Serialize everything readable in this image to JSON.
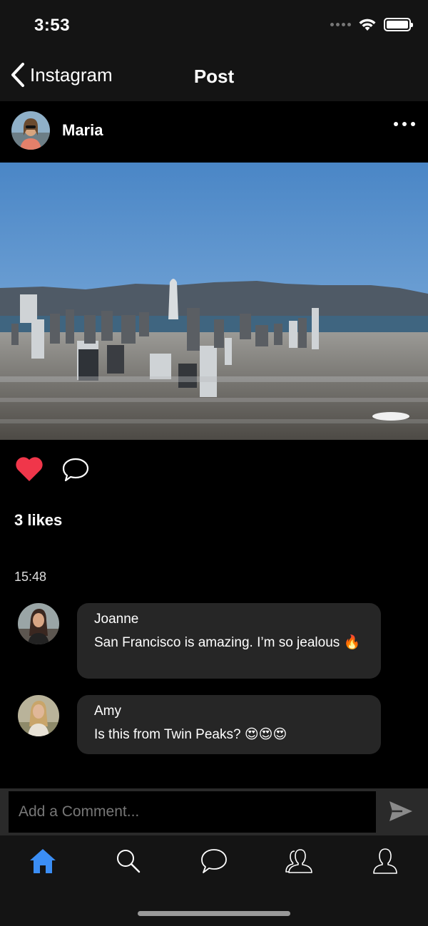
{
  "status_bar": {
    "time": "3:53"
  },
  "nav": {
    "back_label": "Instagram",
    "title": "Post"
  },
  "post": {
    "author": "Maria",
    "likes": "3 likes",
    "time": "15:48",
    "liked": true
  },
  "comments": [
    {
      "author": "Joanne",
      "text": "San Francisco is amazing. I’m so jealous 🔥"
    },
    {
      "author": "Amy",
      "text": "Is this from Twin Peaks? 😍😍😍"
    }
  ],
  "comment_input": {
    "placeholder": "Add a Comment..."
  },
  "tabs": [
    {
      "id": "home",
      "active": true
    },
    {
      "id": "search",
      "active": false
    },
    {
      "id": "messages",
      "active": false
    },
    {
      "id": "friends",
      "active": false
    },
    {
      "id": "profile",
      "active": false
    }
  ],
  "colors": {
    "accent": "#3b8ef5",
    "like": "#f0364a",
    "background": "#000000",
    "bar": "#141414",
    "bubble": "#262626"
  },
  "icons": [
    "back-chevron-icon",
    "wifi-icon",
    "battery-icon",
    "more-icon",
    "heart-icon",
    "comment-icon",
    "send-icon",
    "home-icon",
    "search-icon",
    "chat-icon",
    "friends-icon",
    "profile-icon"
  ]
}
